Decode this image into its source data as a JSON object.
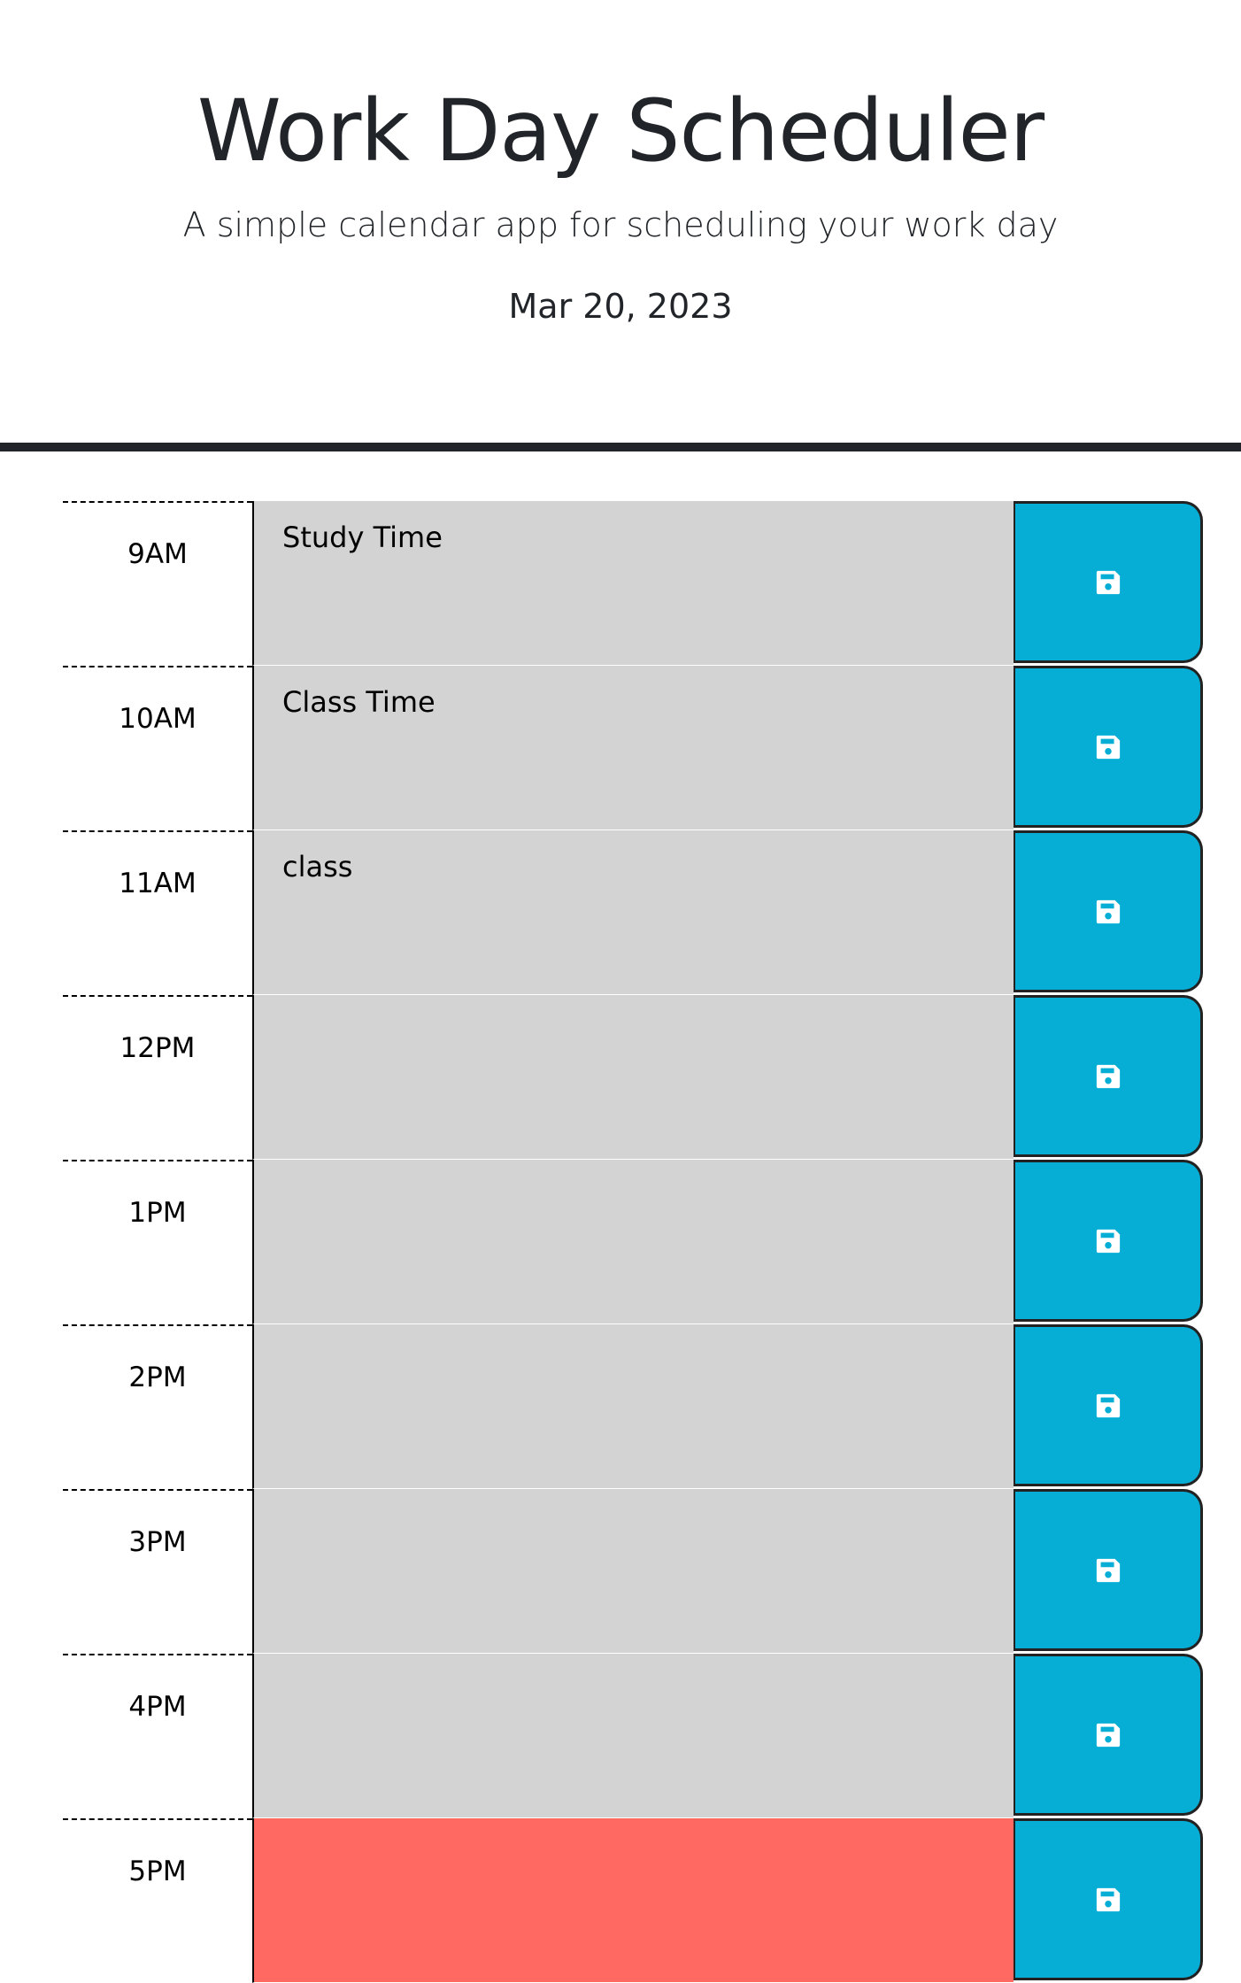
{
  "header": {
    "title": "Work Day Scheduler",
    "subtitle": "A simple calendar app for scheduling your work day",
    "date": "Mar 20, 2023"
  },
  "colors": {
    "past": "#d3d3d3",
    "present": "#ff6961",
    "save_button": "#06aed5",
    "header_border": "#212529"
  },
  "rows": [
    {
      "hour": "9AM",
      "text": "Study Time",
      "state": "past",
      "icon": "save-icon"
    },
    {
      "hour": "10AM",
      "text": "Class Time",
      "state": "past",
      "icon": "save-icon"
    },
    {
      "hour": "11AM",
      "text": "class",
      "state": "past",
      "icon": "save-icon"
    },
    {
      "hour": "12PM",
      "text": "",
      "state": "past",
      "icon": "save-icon"
    },
    {
      "hour": "1PM",
      "text": "",
      "state": "past",
      "icon": "save-icon"
    },
    {
      "hour": "2PM",
      "text": "",
      "state": "past",
      "icon": "save-icon"
    },
    {
      "hour": "3PM",
      "text": "",
      "state": "past",
      "icon": "save-icon"
    },
    {
      "hour": "4PM",
      "text": "",
      "state": "past",
      "icon": "save-icon"
    },
    {
      "hour": "5PM",
      "text": "",
      "state": "present",
      "icon": "save-icon"
    }
  ]
}
